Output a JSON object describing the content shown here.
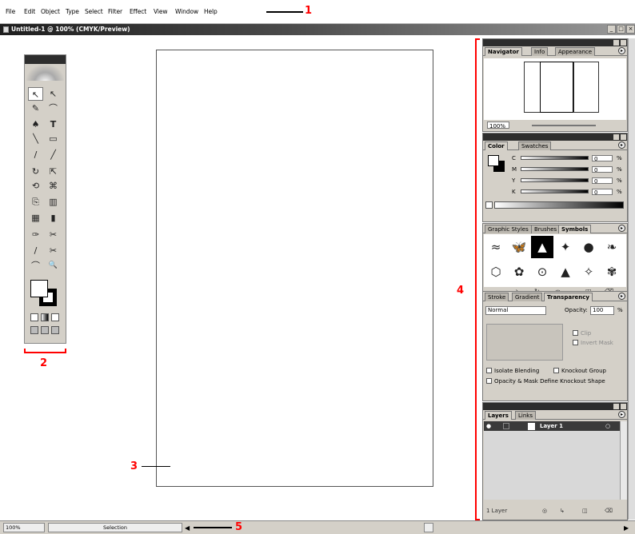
{
  "menubar": {
    "items": [
      "File",
      "Edit",
      "Object",
      "Type",
      "Select",
      "Filter",
      "Effect",
      "View",
      "Window",
      "Help"
    ]
  },
  "callouts": {
    "one": "1",
    "two": "2",
    "three": "3",
    "four": "4",
    "five": "5"
  },
  "window": {
    "title": "Untitled-1 @ 100% (CMYK/Preview)",
    "min_label": "_",
    "max_label": "□",
    "close_label": "×"
  },
  "toolbox": {
    "tools": [
      "↖",
      "↖",
      "✎",
      "⌒",
      "♠",
      "T",
      "╲",
      "▭",
      "/",
      "╱",
      "↻",
      "⇱",
      "⟲",
      "⌘",
      "⎘",
      "▥",
      "▦",
      "▮",
      "✑",
      "✂",
      "/",
      "✂",
      "⌒",
      "🔍"
    ]
  },
  "navigator_panel": {
    "tabs": [
      "Navigator",
      "Info",
      "Appearance"
    ],
    "zoom": "100%"
  },
  "color_panel": {
    "tabs": [
      "Color",
      "Swatches"
    ],
    "channels": [
      {
        "label": "C",
        "value": "0",
        "unit": "%"
      },
      {
        "label": "M",
        "value": "0",
        "unit": "%"
      },
      {
        "label": "Y",
        "value": "0",
        "unit": "%"
      },
      {
        "label": "K",
        "value": "0",
        "unit": "%"
      }
    ]
  },
  "symbols_panel": {
    "tabs": [
      "Graphic Styles",
      "Brushes",
      "Symbols"
    ],
    "symbols": [
      "≈",
      "🦋",
      "▲",
      "✦",
      "●",
      "❧",
      "⬡",
      "✿",
      "⊙",
      "▲",
      "✧",
      "✾"
    ]
  },
  "transparency_panel": {
    "tabs": [
      "Stroke",
      "Gradient",
      "Transparency"
    ],
    "blend_mode": "Normal",
    "opacity_label": "Opacity:",
    "opacity_value": "100",
    "opacity_unit": "%",
    "clip_label": "Clip",
    "invert_mask_label": "Invert Mask",
    "isolate_blending_label": "Isolate Blending",
    "knockout_group_label": "Knockout Group",
    "opacity_mask_label": "Opacity & Mask Define Knockout Shape"
  },
  "layers_panel": {
    "tabs": [
      "Layers",
      "Links"
    ],
    "layer_name": "Layer 1",
    "count": "1 Layer"
  },
  "statusbar": {
    "zoom": "100%",
    "tool": "Selection"
  }
}
